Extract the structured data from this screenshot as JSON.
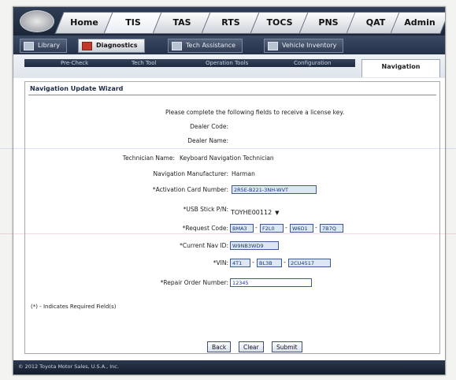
{
  "top_tabs": [
    "Home",
    "TIS",
    "TAS",
    "RTS",
    "TOCS",
    "PNS",
    "QAT",
    "Admin"
  ],
  "sub_tabs": [
    "Library",
    "Diagnostics",
    "Tech Assistance",
    "Vehicle Inventory"
  ],
  "third_tabs": [
    "Pre-Check",
    "Tech Tool",
    "Operation Tools",
    "Configuration",
    "Navigation"
  ],
  "panel": {
    "title": "Navigation Update Wizard",
    "intro": "Please complete the following fields to receive a license key."
  },
  "fields": {
    "dealer_code_label": "Dealer Code:",
    "dealer_name_label": "Dealer Name:",
    "technician_label": "Technician Name:",
    "technician_value": "Keyboard Navigation Technician",
    "manufacturer_label": "Navigation Manufacturer:",
    "manufacturer_value": "Harman",
    "activation_label": "*Activation Card Number:",
    "activation_value": "2R5E-B221-3NH-WVT",
    "usb_label": "*USB Stick P/N:",
    "usb_value": "TOYHE00112",
    "request_code_label": "*Request Code:",
    "request_code_parts": [
      "BMA3",
      "F2L0",
      "W6D1",
      "7B7Q"
    ],
    "current_nav_label": "*Current Nav ID:",
    "current_nav_value": "W9NB3WD9",
    "vin_label": "*VIN:",
    "vin_parts": [
      "4T1",
      "BL3B",
      "2CU4517"
    ],
    "ro_label": "*Repair Order Number:",
    "ro_value": "12345"
  },
  "required_note": "(*) - Indicates Required Field(s)",
  "buttons": {
    "back": "Back",
    "clear": "Clear",
    "submit": "Submit"
  },
  "footer_text": "© 2012 Toyota Motor Sales, U.S.A., Inc."
}
